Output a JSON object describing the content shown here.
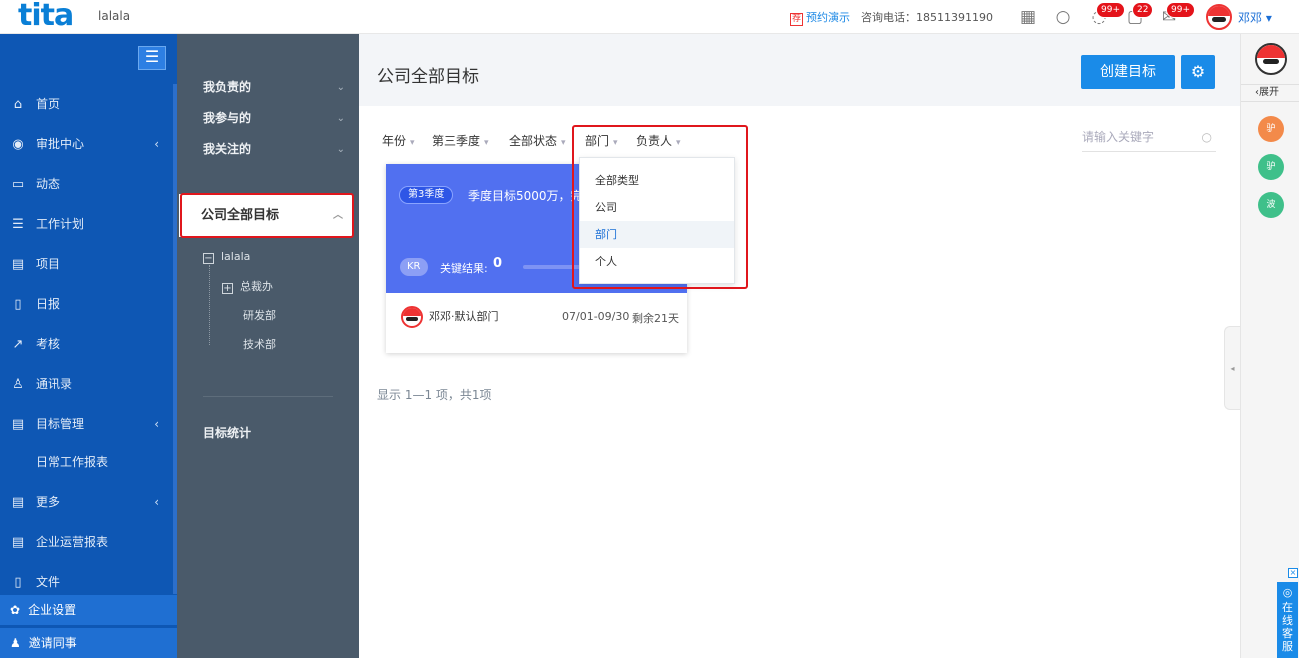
{
  "topbar": {
    "logo": "tita",
    "tenant": "lalala",
    "demo_badge": "荐",
    "demo_label": "预约演示",
    "phone": "咨询电话：18511391190",
    "badges": {
      "chat": "99+",
      "tasks": "22",
      "mail": "99+"
    },
    "username": "邓邓 ▾"
  },
  "sidebar": {
    "items": [
      {
        "label": "首页",
        "icon": "⌂"
      },
      {
        "label": "审批中心",
        "icon": "◉",
        "caret": "‹"
      },
      {
        "label": "动态",
        "icon": "▭"
      },
      {
        "label": "工作计划",
        "icon": "☰"
      },
      {
        "label": "项目",
        "icon": "▤"
      },
      {
        "label": "日报",
        "icon": "▯"
      },
      {
        "label": "考核",
        "icon": "↗"
      },
      {
        "label": "通讯录",
        "icon": "♙"
      },
      {
        "label": "目标管理",
        "icon": "▤",
        "caret": "‹"
      },
      {
        "label": "日常工作报表",
        "icon": ""
      },
      {
        "label": "更多",
        "icon": "▤",
        "caret": "‹"
      },
      {
        "label": "企业运营报表",
        "icon": "▤"
      },
      {
        "label": "文件",
        "icon": "▯"
      }
    ],
    "bottom": [
      {
        "label": "企业设置",
        "icon": "✿"
      },
      {
        "label": "邀请同事",
        "icon": "♟"
      }
    ]
  },
  "goal_nav": {
    "mine": "我负责的",
    "joined": "我参与的",
    "followed": "我关注的",
    "company": "公司全部目标",
    "tree": {
      "root": "lalala",
      "ceo": "总裁办",
      "rd": "研发部",
      "tech": "技术部"
    },
    "stats": "目标统计"
  },
  "main": {
    "title": "公司全部目标",
    "create_label": "创建目标",
    "filters": {
      "year": "年份",
      "quarter": "第三季度",
      "status": "全部状态",
      "dept": "部门",
      "owner": "负责人"
    },
    "search_placeholder": "请输入关键字",
    "card": {
      "quarter_badge": "第3季度",
      "title": "季度目标5000万，完",
      "kr_pill": "KR",
      "kr_label": "关键结果:",
      "kr_count": "0",
      "owner": "邓邓·默认部门",
      "date_range": "07/01-09/30",
      "remaining": "剩余21天"
    },
    "page_info": "显示 1—1 项，共1项"
  },
  "dept_dropdown": {
    "options": [
      "全部类型",
      "公司",
      "部门",
      "个人"
    ],
    "selected": "部门"
  },
  "rightbar": {
    "expand_label": "展开",
    "contacts": [
      {
        "label": "驴",
        "color": "#f38a4a"
      },
      {
        "label": "驴",
        "color": "#3fc08a"
      },
      {
        "label": "波",
        "color": "#3fc08a"
      }
    ]
  },
  "service": {
    "label": "在线客服"
  }
}
